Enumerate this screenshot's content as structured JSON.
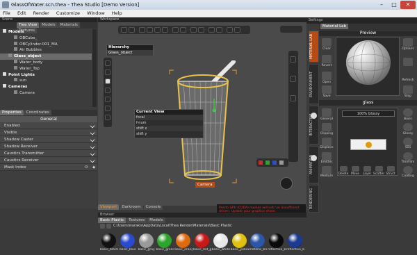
{
  "window": {
    "title": "GlassOfWater.scn.thea - Thea Studio [Demo Version]",
    "min": "–",
    "max": "□",
    "close": "✕"
  },
  "menu": [
    "File",
    "Edit",
    "Render",
    "Customize",
    "Window",
    "Help"
  ],
  "scene": {
    "header": "Scene",
    "tabs": [
      "Tree View",
      "Models",
      "Materials",
      "Textures"
    ],
    "tree": [
      {
        "label": "Models",
        "level": 0,
        "group": true
      },
      {
        "label": "OBCube_",
        "level": 2
      },
      {
        "label": "OBCylinder.001_MA",
        "level": 2
      },
      {
        "label": "Air Bubbles",
        "level": 2
      },
      {
        "label": "Glass_object",
        "level": 1,
        "selected": true
      },
      {
        "label": "Water_body",
        "level": 2
      },
      {
        "label": "Water_Top",
        "level": 2
      },
      {
        "label": "Point Lights",
        "level": 0,
        "group": true
      },
      {
        "label": "sun",
        "level": 2
      },
      {
        "label": "Cameras",
        "level": 0,
        "group": true
      },
      {
        "label": "Camera",
        "level": 2
      }
    ]
  },
  "properties": {
    "tabs": [
      "Properties",
      "Coordinates"
    ],
    "section": "General",
    "rows": [
      "Enabled",
      "Visible",
      "Shadow Caster",
      "Shadow Receiver",
      "Caustics Transmitter",
      "Caustics Receiver"
    ],
    "mask_label": "Mask Index",
    "mask_value": "0"
  },
  "workspace": {
    "header": "Workspace",
    "hierarchy_title": "Hierarchy",
    "hierarchy_item": "Glass_object",
    "current_view": {
      "title": "Current View",
      "rows": [
        "focal",
        "f-num",
        "shift x",
        "shift y"
      ]
    },
    "camera_label": "Camera"
  },
  "bottom_tabs": [
    "Viewport",
    "Darkroom",
    "Console"
  ],
  "browser": {
    "header": "Browser",
    "tabs": [
      "Basic Plastic",
      "Textures",
      "Models"
    ],
    "path": "C:\\Users\\ivarakis\\AppData\\Local\\Thea Render\\Materials\\Basic Plastic",
    "swatches": [
      {
        "label": "basic_black",
        "color": "#111111"
      },
      {
        "label": "basic_blue",
        "color": "#2a4bd0"
      },
      {
        "label": "basic_gray",
        "color": "#9a9a9a"
      },
      {
        "label": "basic_green",
        "color": "#2ea32e"
      },
      {
        "label": "basic_orange",
        "color": "#e06a10"
      },
      {
        "label": "basic_red_gl",
        "color": "#c81818"
      },
      {
        "label": "basic_white",
        "color": "#e8e8e8"
      },
      {
        "label": "basic_yellow",
        "color": "#e0c010"
      },
      {
        "label": "metallic_blu",
        "color": "#2c56a8"
      },
      {
        "label": "reflective_b",
        "color": "#0a0a0a"
      },
      {
        "label": "reflective_b",
        "color": "#1b3a90"
      }
    ]
  },
  "messages": {
    "line1": "Presto GPU (CUDA) module will not run (insufficient driver). Update your graphics driver.",
    "line2": "Presto will run only on the CPU."
  },
  "settings": {
    "header": "Settings",
    "tab": "Material Lab",
    "vtabs": [
      "MATERIAL LAB",
      "ENVIRONMENT",
      "INTERACTIVE",
      "ANIMATION",
      "RENDERING"
    ],
    "preview_title": "Preview",
    "material_title": "glass",
    "glossy_label": "100% Glossy",
    "left_buttons": [
      "Clear",
      "Revert",
      "Open",
      "Save"
    ],
    "right_buttons": [
      "Options",
      "Refresh",
      "Stop"
    ],
    "layer_left": [
      "General",
      "Clipping",
      "Displace",
      "Emitter",
      "Medium"
    ],
    "layer_right": [
      "Basic",
      "Glossy",
      "SSS",
      "ThinFilm",
      "Coating"
    ],
    "layer_bottom": [
      "Delete",
      "Move",
      "Layer",
      "Scatter",
      "Struct"
    ]
  },
  "colors": {
    "accent": "#b84a14",
    "highlight": "#e8c34a"
  }
}
